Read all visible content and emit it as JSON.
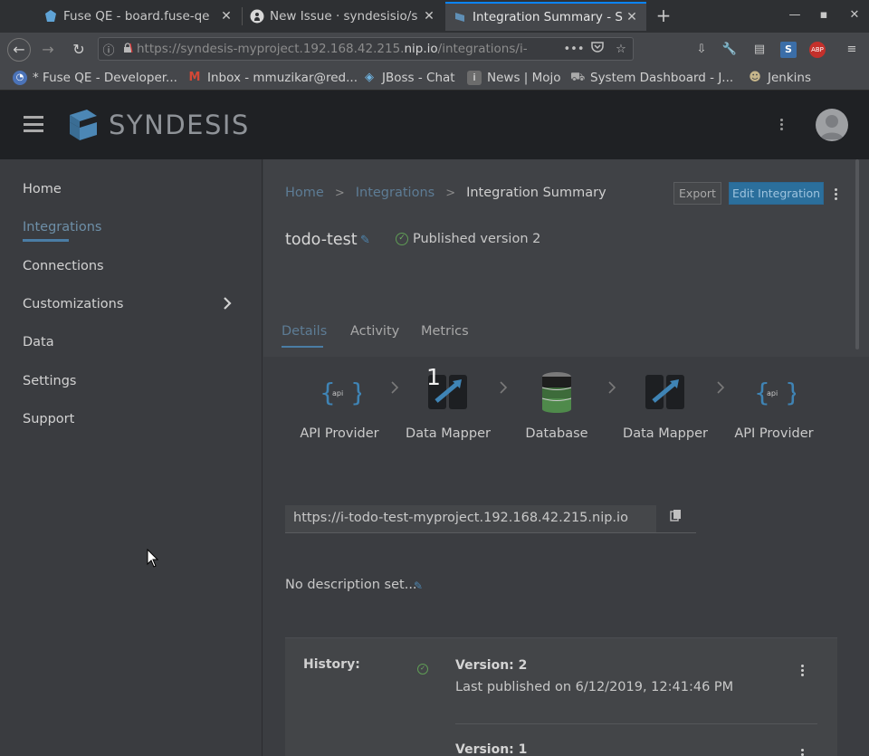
{
  "browser": {
    "tabs": [
      {
        "title": "Fuse QE - board.fuse-qe",
        "icon": "zenhub-icon"
      },
      {
        "title": "New Issue · syndesisio/s",
        "icon": "github-icon"
      },
      {
        "title": "Integration Summary - S",
        "icon": "syndesis-icon"
      }
    ],
    "url_prefix": "https://syndesis-myproject.192.168.42.215.",
    "url_host": "nip.io",
    "url_suffix": "/integrations/i-",
    "bookmarks": [
      {
        "label": "* Fuse QE - Developer...",
        "icon": "firefox-icon"
      },
      {
        "label": "Inbox - mmuzikar@red...",
        "icon": "gmail-icon"
      },
      {
        "label": "JBoss - Chat",
        "icon": "chat-icon"
      },
      {
        "label": "News | Mojo",
        "icon": "mojo-icon"
      },
      {
        "label": "System Dashboard - J...",
        "icon": "jira-icon"
      },
      {
        "label": "Jenkins",
        "icon": "jenkins-icon"
      }
    ]
  },
  "app": {
    "logo_text": "SYNDESIS"
  },
  "sidebar": {
    "items": [
      {
        "label": "Home"
      },
      {
        "label": "Integrations"
      },
      {
        "label": "Connections"
      },
      {
        "label": "Customizations"
      },
      {
        "label": "Data"
      },
      {
        "label": "Settings"
      },
      {
        "label": "Support"
      }
    ],
    "active": "Integrations"
  },
  "breadcrumb": {
    "home": "Home",
    "integrations": "Integrations",
    "current": "Integration Summary"
  },
  "actions": {
    "export": "Export",
    "edit": "Edit Integration"
  },
  "integration": {
    "name": "todo-test",
    "status": "Published version 2",
    "url": "https://i-todo-test-myproject.192.168.42.215.nip.io",
    "description": "No description set..."
  },
  "tabs": [
    "Details",
    "Activity",
    "Metrics"
  ],
  "active_tab": "Details",
  "flow": {
    "badge": "1",
    "steps": [
      {
        "label": "API Provider",
        "icon": "api-icon"
      },
      {
        "label": "Data Mapper",
        "icon": "data-mapper-icon"
      },
      {
        "label": "Database",
        "icon": "database-icon"
      },
      {
        "label": "Data Mapper",
        "icon": "data-mapper-icon"
      },
      {
        "label": "API Provider",
        "icon": "api-icon"
      }
    ]
  },
  "history": {
    "label": "History:",
    "versions": [
      {
        "version": "Version: 2",
        "date": "Last published on 6/12/2019, 12:41:46 PM"
      },
      {
        "version": "Version: 1"
      }
    ]
  }
}
